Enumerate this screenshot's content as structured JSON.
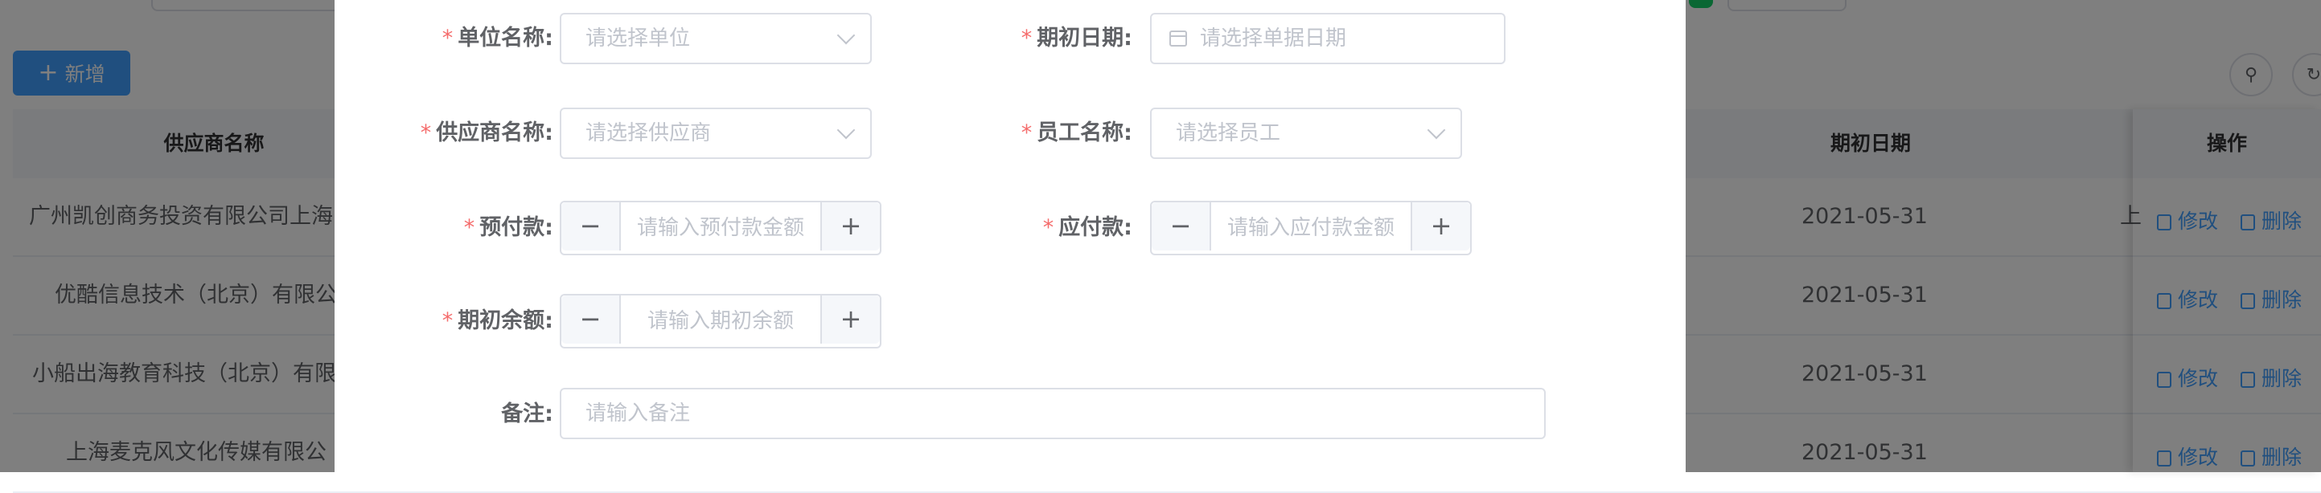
{
  "background": {
    "add_button": {
      "icon": "plus-icon",
      "label": "新增"
    },
    "table": {
      "columns": {
        "supplier": "供应商名称",
        "date": "期初日期",
        "ops": "操作"
      },
      "rows": [
        {
          "supplier": "广州凯创商务投资有限公司上海",
          "date": "2021-05-31",
          "trail": "上"
        },
        {
          "supplier": "优酷信息技术（北京）有限公",
          "date": "2021-05-31",
          "trail": ""
        },
        {
          "supplier": "小船出海教育科技（北京）有限",
          "date": "2021-05-31",
          "trail": ""
        },
        {
          "supplier": "上海麦克风文化传媒有限公",
          "date": "2021-05-31",
          "trail": ""
        }
      ],
      "edit_label": "修改",
      "delete_label": "删除"
    },
    "toolbar_icons": [
      "search-icon",
      "refresh-icon"
    ]
  },
  "dialog": {
    "unit": {
      "label": "单位名称:",
      "placeholder": "请选择单位"
    },
    "date": {
      "label": "期初日期:",
      "placeholder": "请选择单据日期"
    },
    "supplier": {
      "label": "供应商名称:",
      "placeholder": "请选择供应商"
    },
    "employee": {
      "label": "员工名称:",
      "placeholder": "请选择员工"
    },
    "prepay": {
      "label": "预付款:",
      "placeholder": "请输入预付款金额"
    },
    "payable": {
      "label": "应付款:",
      "placeholder": "请输入应付款金额"
    },
    "balance": {
      "label": "期初余额:",
      "placeholder": "请输入期初余额"
    },
    "remark": {
      "label": "备注:",
      "placeholder": "请输入备注"
    },
    "required_mark": "*",
    "minus": "−",
    "plus": "+"
  },
  "colors": {
    "primary": "#409eff",
    "required": "#f56c6c",
    "mask": "rgba(0,0,0,0.5)"
  }
}
